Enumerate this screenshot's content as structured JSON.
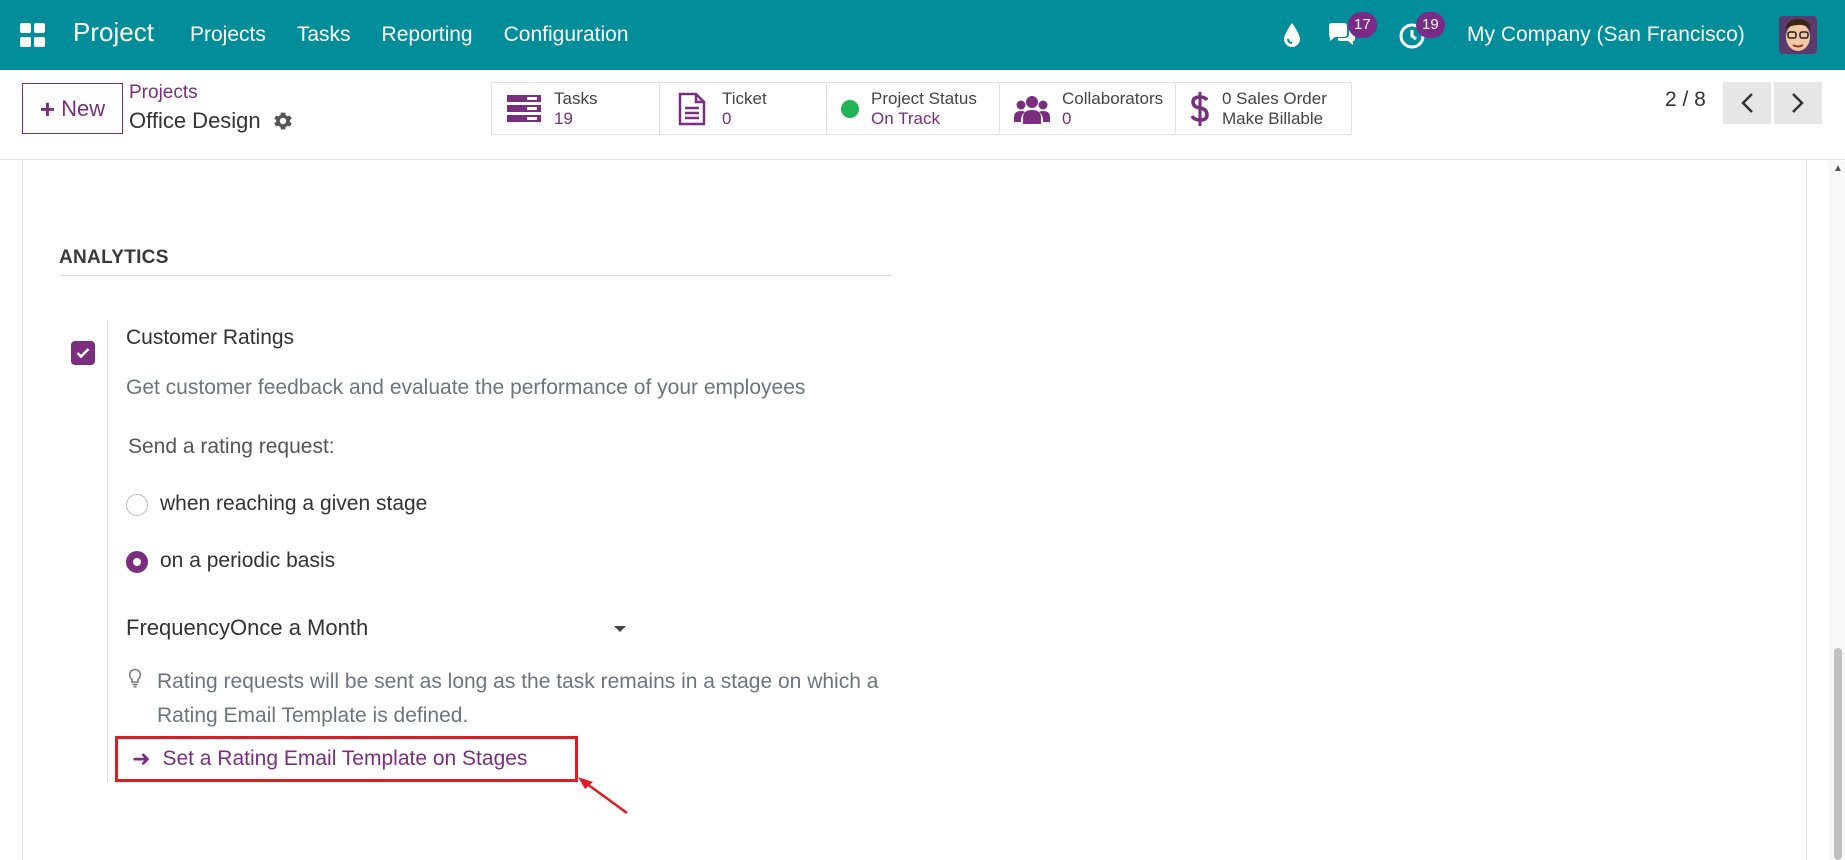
{
  "navbar": {
    "app_title": "Project",
    "menu": [
      "Projects",
      "Tasks",
      "Reporting",
      "Configuration"
    ],
    "messages_count": "17",
    "activities_count": "19",
    "company": "My Company (San Francisco)"
  },
  "control": {
    "new_label": "New",
    "breadcrumb_parent": "Projects",
    "breadcrumb_current": "Office Design",
    "stats": {
      "tasks_label": "Tasks",
      "tasks_value": "19",
      "ticket_label": "Ticket",
      "ticket_value": "0",
      "status_label": "Project Status",
      "status_value": "On Track",
      "collab_label": "Collaborators",
      "collab_value": "0",
      "sales_label": "0 Sales Order",
      "sales_value": "Make Billable"
    },
    "pager": "2 / 8"
  },
  "analytics": {
    "section_title": "ANALYTICS",
    "setting_title": "Customer Ratings",
    "setting_desc": "Get customer feedback and evaluate the performance of your employees",
    "send_label": "Send a rating request:",
    "option_stage": "when reaching a given stage",
    "option_periodic": "on a periodic basis",
    "frequency_label": "Frequency",
    "frequency_value": "Once a Month",
    "hint": "Rating requests will be sent as long as the task remains in a stage on which a Rating Email Template is defined.",
    "link_label": "Set a Rating Email Template on Stages"
  },
  "colors": {
    "navbar": "#018d99",
    "accent": "#7b2e7f",
    "status_green": "#21b356",
    "highlight_red": "#e11b22"
  }
}
